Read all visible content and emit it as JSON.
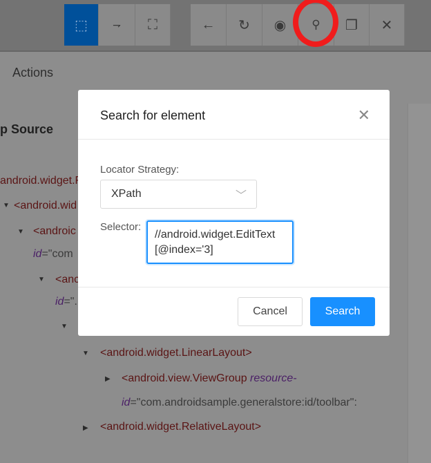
{
  "toolbar": {
    "group1": [
      {
        "icon": "select-element-icon",
        "selected": true
      },
      {
        "icon": "swipe-icon"
      },
      {
        "icon": "tap-coordinates-icon"
      }
    ],
    "group2": [
      {
        "icon": "back-icon"
      },
      {
        "icon": "refresh-icon"
      },
      {
        "icon": "eye-icon"
      },
      {
        "icon": "search-icon",
        "highlighted": true
      },
      {
        "icon": "copy-xml-icon"
      },
      {
        "icon": "close-session-icon"
      }
    ],
    "accent": "#00509a",
    "highlight_color": "#f01c1c"
  },
  "panels": {
    "actions_tab": "Actions",
    "source_title": "p Source"
  },
  "tree": [
    {
      "tag": "android.widget.F"
    },
    {
      "tag": "<android.wid"
    },
    {
      "tag": "<androic"
    },
    {
      "attr": "id",
      "rest": "=\"com"
    },
    {
      "tag": "<anc"
    },
    {
      "attr": "id",
      "rest": "=\"."
    },
    {
      "tag": "<android.widget.LinearLayout>"
    },
    {
      "tag": "<android.view.ViewGroup",
      "attr": "resource-"
    },
    {
      "attr": "id",
      "rest": "=\"com.androidsample.generalstore:id/toolbar\":"
    },
    {
      "tag": "<android.widget.RelativeLayout>"
    }
  ],
  "modal": {
    "title": "Search for element",
    "strategy_label": "Locator Strategy:",
    "strategy_value": "XPath",
    "selector_label": "Selector:",
    "selector_value": "//android.widget.EditText[@index='3]",
    "cancel": "Cancel",
    "search": "Search",
    "primary_color": "#1890ff"
  }
}
